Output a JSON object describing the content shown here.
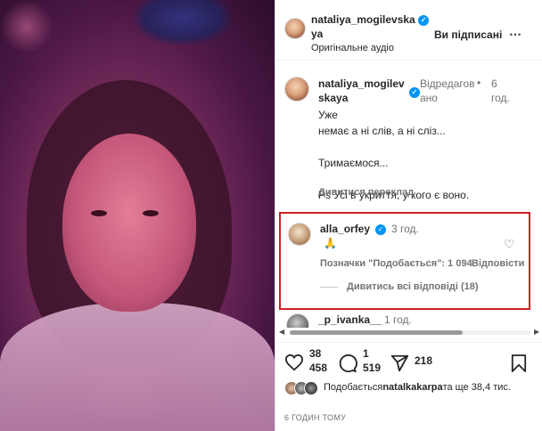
{
  "post": {
    "username_line1": "nataliya_mogilevska",
    "username_line2": "ya",
    "audio": "Оригінальне аудіо",
    "follow_status": "Ви підписані",
    "more": "⋯"
  },
  "caption": {
    "username_line1": "nataliya_mogilev",
    "username_line2": "skaya",
    "edited_line1": "Відредагов",
    "edited_line2": "ано",
    "dot": "•",
    "time_line1": "6",
    "time_line2": "год.",
    "text": "Уже\nнемає а ні слів, а ні сліз...\n\nТримаємося...\n\nPs Усі в укриття, у кого є воно.",
    "translate": "Дивитися переклад"
  },
  "highlighted_comment": {
    "username": "alla_orfey",
    "time": "3 год.",
    "emoji": "🙏",
    "likes": "Позначки \"Подобається\": 1 094",
    "reply": "Відповісти",
    "view_replies": "Дивитись всі відповіді (18)",
    "border_color": "#cf2027"
  },
  "next_comment": {
    "username": "_p_ivanka__",
    "time": "1 год."
  },
  "actions": {
    "likes_line1": "38",
    "likes_line2": "458",
    "comments_line1": "1",
    "comments_line2": "519",
    "shares": "218"
  },
  "liked_by": {
    "prefix": "Подобається",
    "user": "natalkakarpa",
    "suffix": "та ще 38,4 тис."
  },
  "time_ago": "6 ГОДИН ТОМУ"
}
